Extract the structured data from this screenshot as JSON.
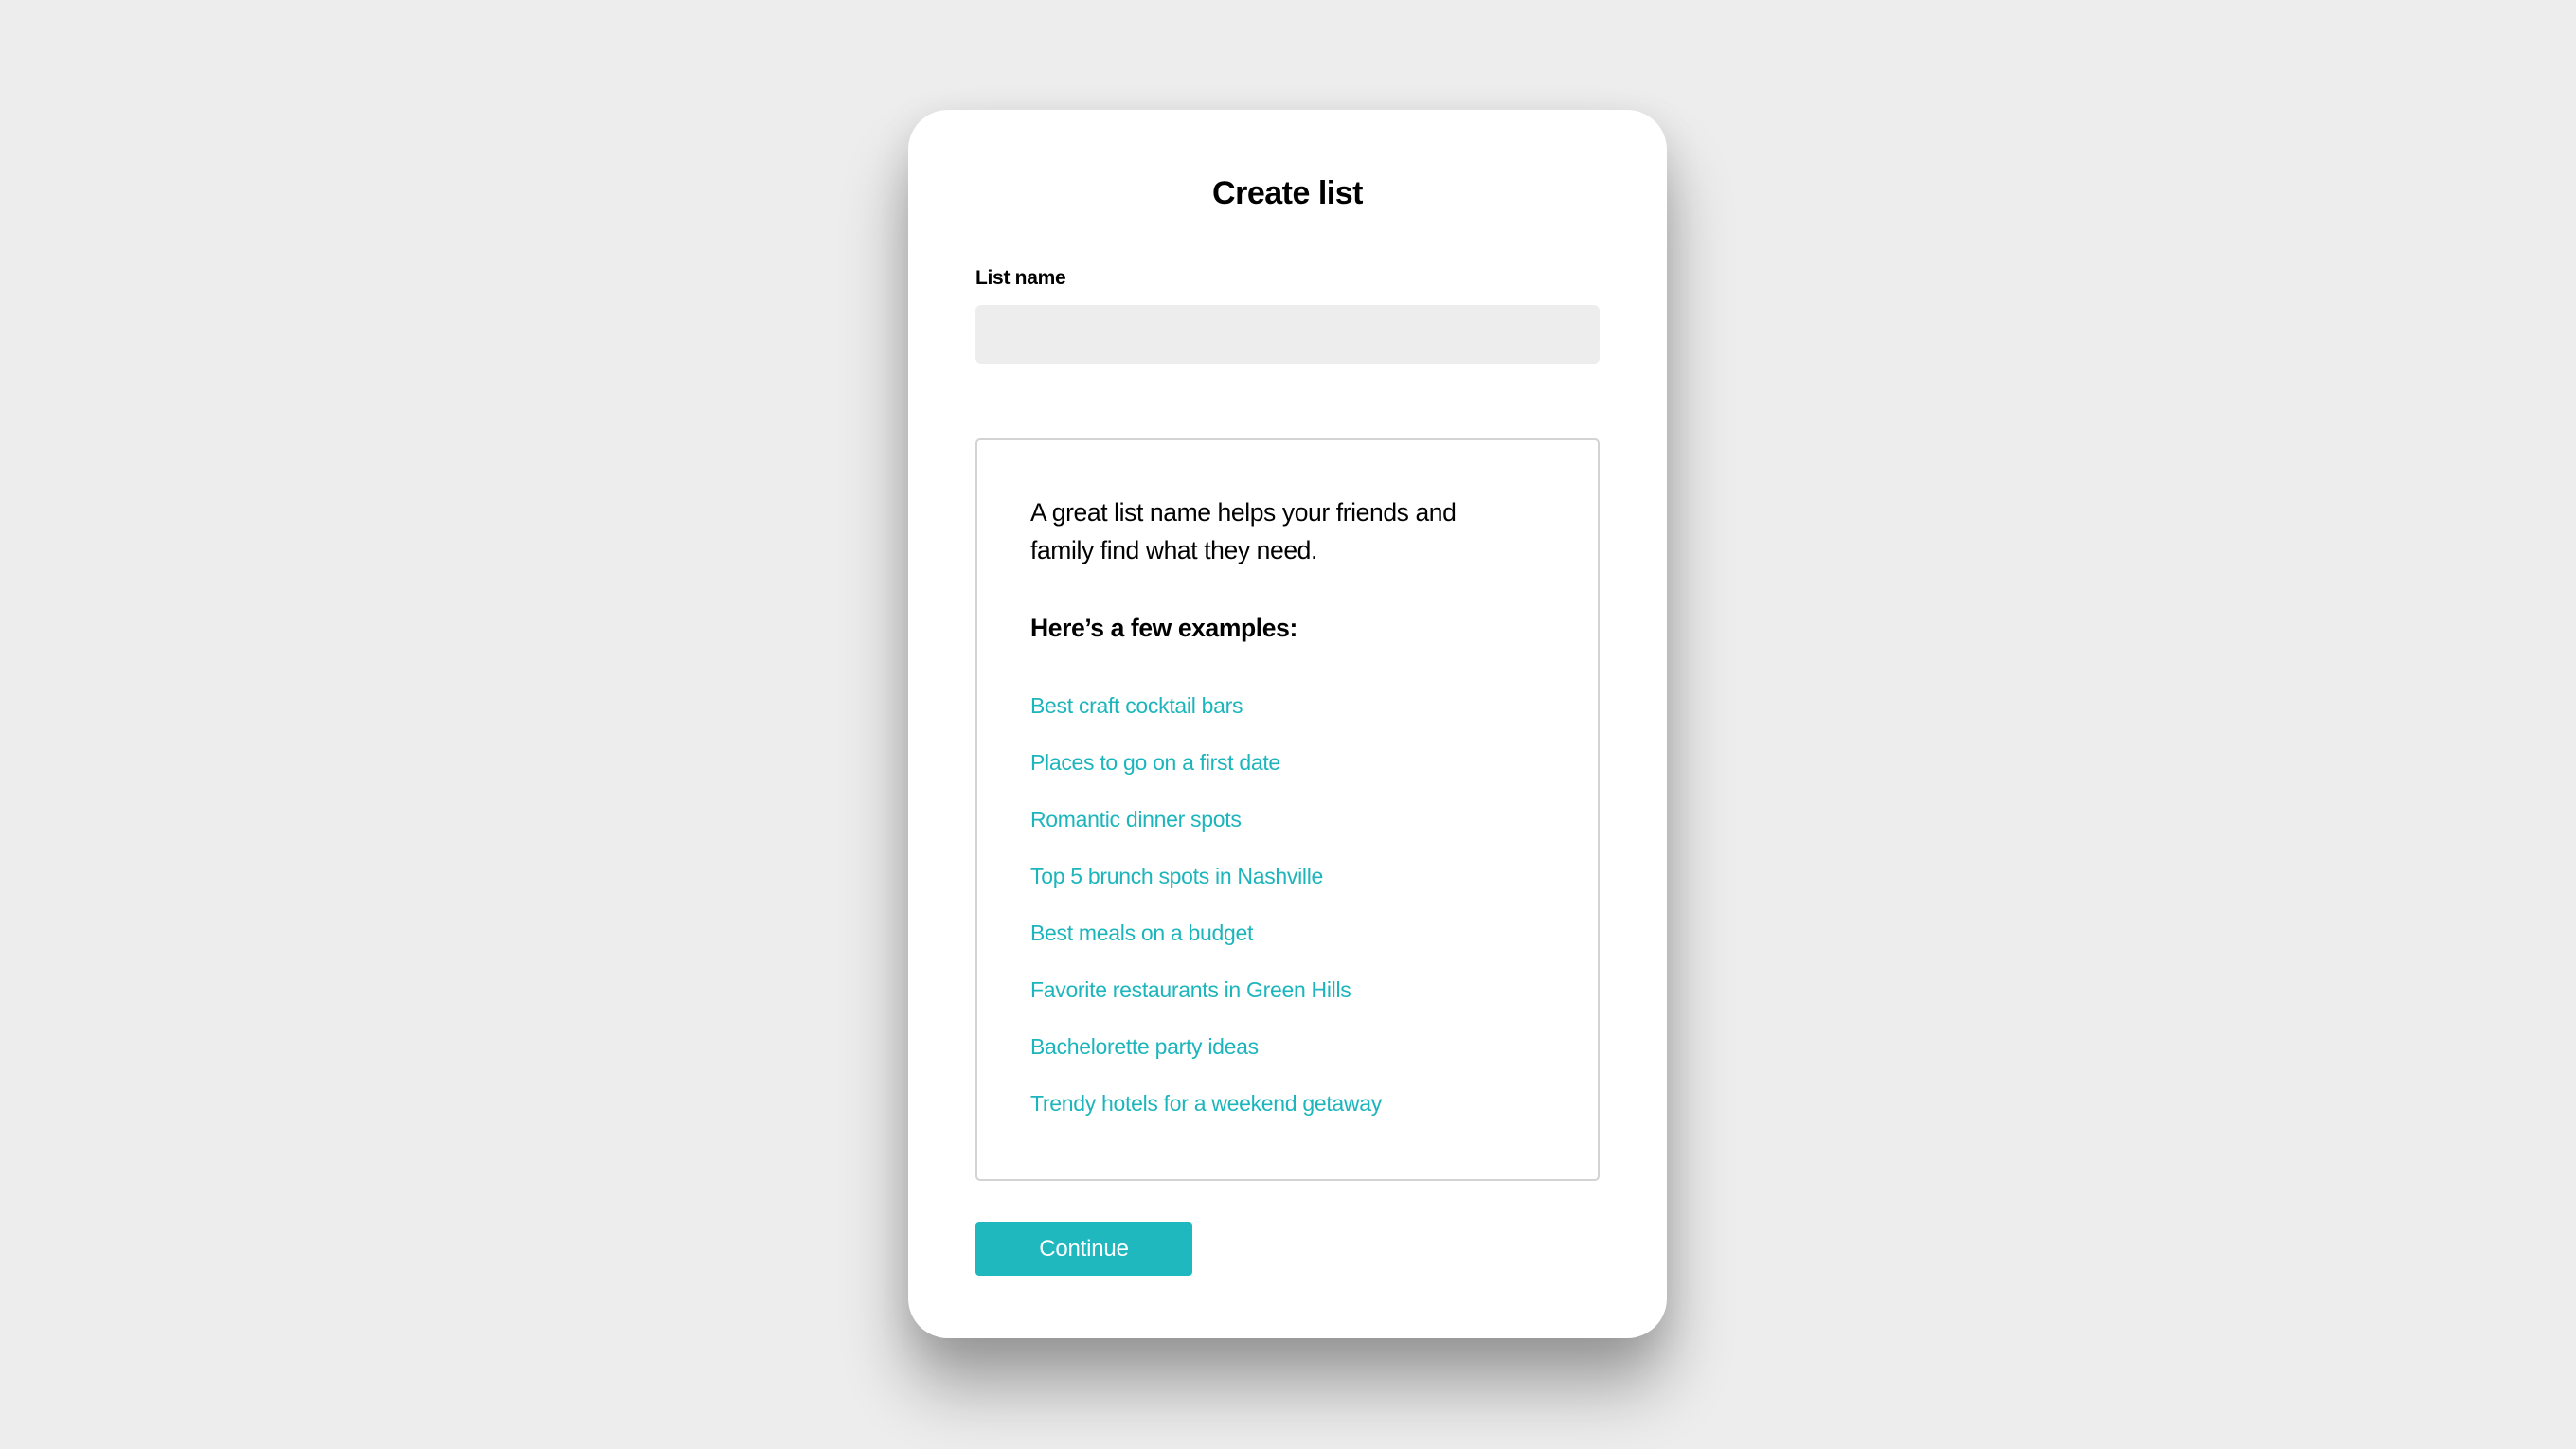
{
  "dialog": {
    "title": "Create list"
  },
  "form": {
    "list_name_label": "List name",
    "list_name_value": "",
    "list_name_placeholder": ""
  },
  "examples_box": {
    "intro_lines": [
      "A great list name helps your friends and",
      "family find what they need."
    ],
    "heading": "Here’s a few examples:",
    "examples": [
      "Best craft cocktail bars",
      "Places to go on a first date",
      "Romantic dinner spots",
      "Top 5 brunch spots in Nashville",
      "Best meals on a budget",
      "Favorite restaurants in Green Hills",
      "Bachelorette party ideas",
      "Trendy hotels for a weekend getaway"
    ]
  },
  "actions": {
    "continue_label": "Continue"
  },
  "colors": {
    "accent": "#1FB8BE",
    "link": "#1CB5BC",
    "background": "#EDEDED",
    "input_background": "#EDEDED",
    "box_border": "#D3D3D3"
  }
}
